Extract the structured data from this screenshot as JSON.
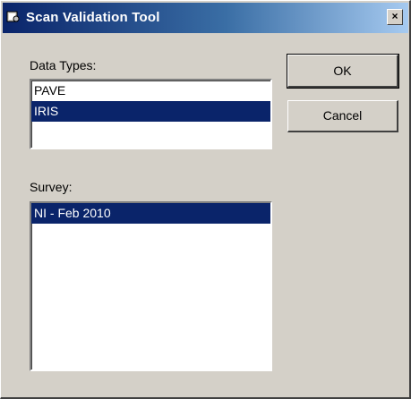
{
  "window": {
    "title": "Scan Validation Tool",
    "icon": "app-icon"
  },
  "titlebar": {
    "close_label": "×",
    "close_icon": "close-icon"
  },
  "data_types": {
    "label": "Data Types:",
    "items": [
      {
        "label": "PAVE"
      },
      {
        "label": "IRIS"
      }
    ],
    "selected_index": 1
  },
  "survey": {
    "label": "Survey:",
    "items": [
      {
        "label": "NI - Feb 2010"
      }
    ],
    "selected_index": 0
  },
  "buttons": {
    "ok_label": "OK",
    "cancel_label": "Cancel"
  },
  "colors": {
    "title_start": "#0a246a",
    "title_end": "#a6caf0",
    "selection": "#0a246a",
    "face": "#d4d0c8"
  }
}
